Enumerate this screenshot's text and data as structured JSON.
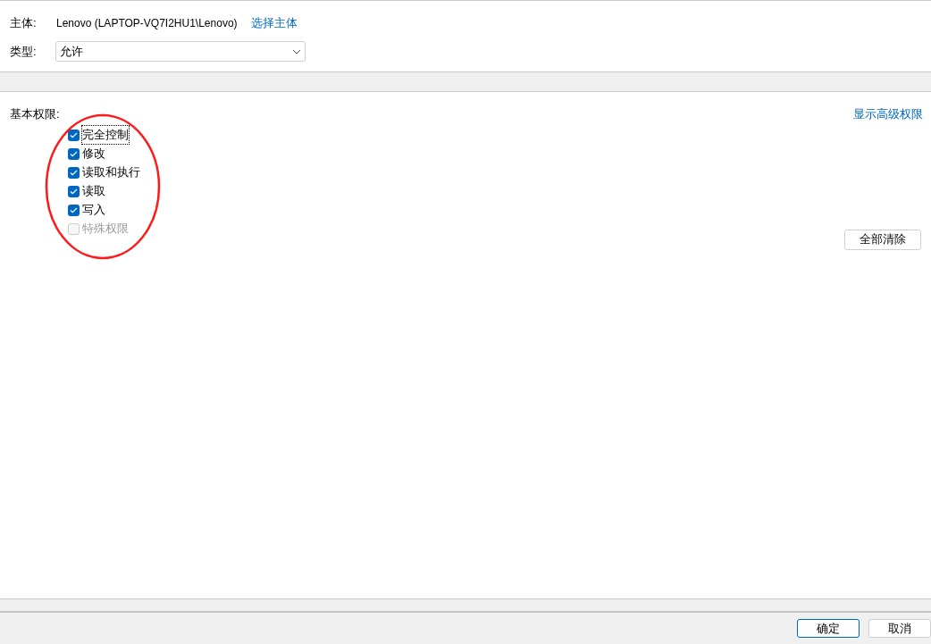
{
  "principal": {
    "label": "主体:",
    "value": "Lenovo (LAPTOP-VQ7I2HU1\\Lenovo)",
    "link": "选择主体"
  },
  "type": {
    "label": "类型:",
    "value": "允许"
  },
  "permissions": {
    "title": "基本权限:",
    "advanced_link": "显示高级权限",
    "items": [
      {
        "label": "完全控制",
        "checked": true,
        "disabled": false,
        "focused": true
      },
      {
        "label": "修改",
        "checked": true,
        "disabled": false,
        "focused": false
      },
      {
        "label": "读取和执行",
        "checked": true,
        "disabled": false,
        "focused": false
      },
      {
        "label": "读取",
        "checked": true,
        "disabled": false,
        "focused": false
      },
      {
        "label": "写入",
        "checked": true,
        "disabled": false,
        "focused": false
      },
      {
        "label": "特殊权限",
        "checked": false,
        "disabled": true,
        "focused": false
      }
    ],
    "clear_button": "全部清除"
  },
  "buttons": [
    {
      "label": "确定",
      "default": true
    },
    {
      "label": "取消",
      "default": false
    }
  ]
}
